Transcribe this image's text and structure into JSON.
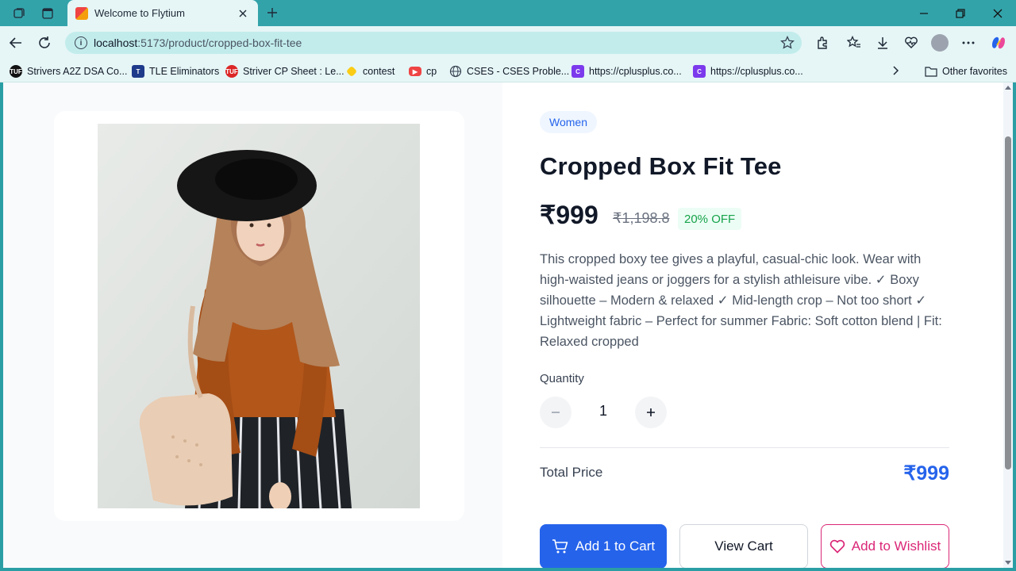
{
  "browser": {
    "tab_title": "Welcome to Flytium",
    "url_host": "localhost",
    "url_path": ":5173/product/cropped-box-fit-tee"
  },
  "favorites": [
    {
      "label": "Strivers A2Z DSA Co...",
      "icon": "tuf-icon",
      "color": "#111111"
    },
    {
      "label": "TLE Eliminators",
      "icon": "tle-icon",
      "color": "#1e3a8a"
    },
    {
      "label": "Striver CP Sheet : Le...",
      "icon": "tuf-red-icon",
      "color": "#dc2626"
    },
    {
      "label": "contest",
      "icon": "codechef-icon",
      "color": "#2563eb"
    },
    {
      "label": "cp",
      "icon": "youtube-icon",
      "color": "#ef4444"
    },
    {
      "label": "CSES - CSES Proble...",
      "icon": "globe-icon",
      "color": "#374151"
    },
    {
      "label": "https://cplusplus.co...",
      "icon": "cplusplus-icon",
      "color": "#7c3aed"
    },
    {
      "label": "https://cplusplus.co...",
      "icon": "cplusplus-icon",
      "color": "#7c3aed"
    }
  ],
  "other_favorites": "Other favorites",
  "product": {
    "category": "Women",
    "title": "Cropped Box Fit Tee",
    "price": "₹999",
    "original_price": "₹1,198.8",
    "discount": "20% OFF",
    "description": "This cropped boxy tee gives a playful, casual-chic look. Wear with high-waisted jeans or joggers for a stylish athleisure vibe. ✓ Boxy silhouette – Modern & relaxed ✓ Mid-length crop – Not too short ✓ Lightweight fabric – Perfect for summer Fabric: Soft cotton blend | Fit: Relaxed cropped",
    "quantity_label": "Quantity",
    "quantity": "1",
    "total_label": "Total Price",
    "total_value": "₹999"
  },
  "actions": {
    "add_to_cart": "Add 1 to Cart",
    "view_cart": "View Cart",
    "add_to_wishlist": "Add to Wishlist"
  },
  "colors": {
    "primary": "#2563eb",
    "wishlist": "#db2777",
    "discount": "#16a34a",
    "browser_frame": "#33a3aa"
  }
}
